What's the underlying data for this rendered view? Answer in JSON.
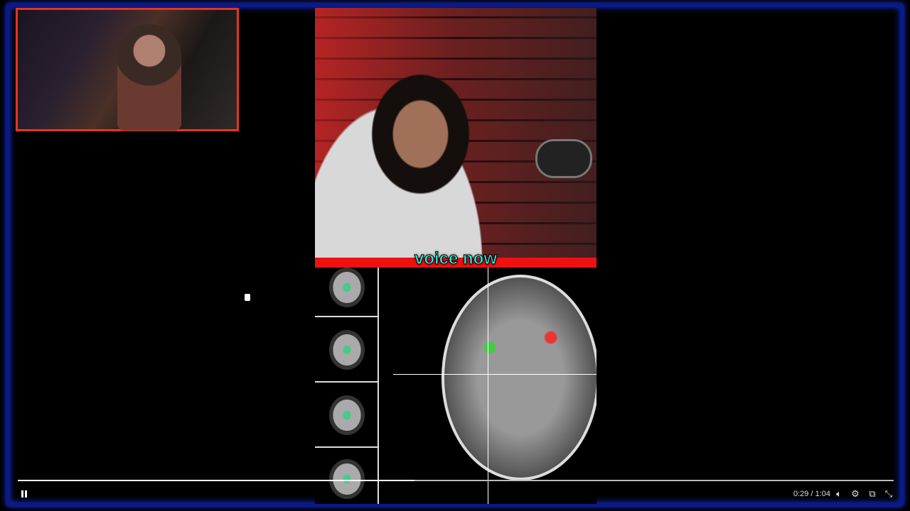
{
  "player": {
    "caption": "voice now",
    "current_time": "0:29",
    "separator": " / ",
    "duration": "1:04",
    "progress_percent": 45.3,
    "state": "playing"
  },
  "icons": {
    "pause": "pause-icon",
    "volume": "volume-icon",
    "settings": "gear-icon",
    "miniplayer": "miniplayer-icon",
    "exit_fullscreen": "exit-fullscreen-icon"
  },
  "colors": {
    "frame": "#0a1a8a",
    "webcam_border": "#e8341c",
    "caption": "#30f0e0"
  }
}
